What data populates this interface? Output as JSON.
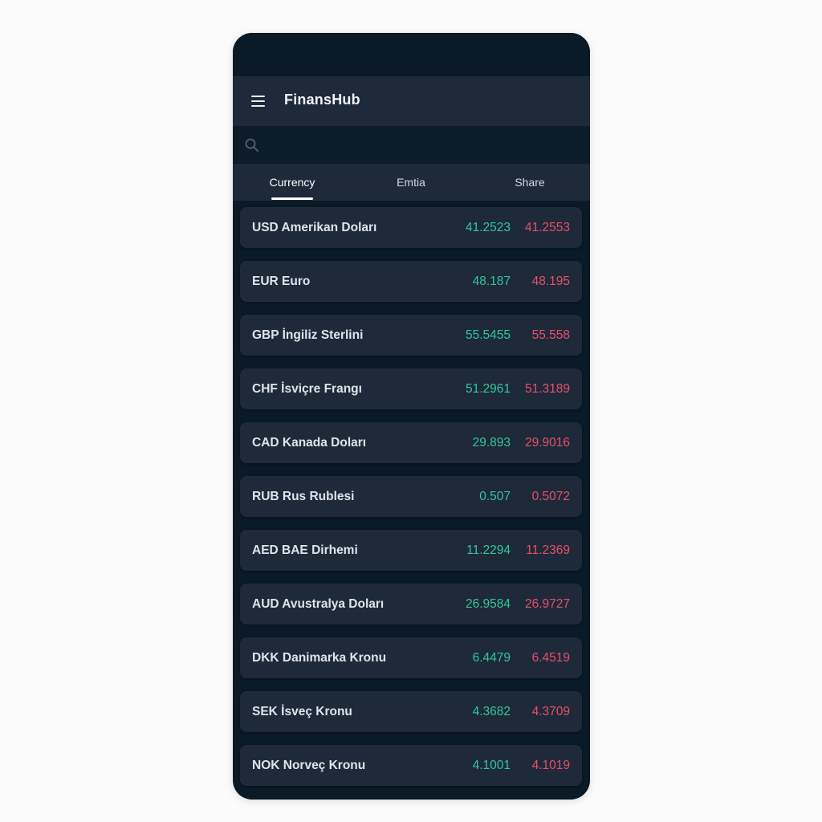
{
  "app": {
    "title": "FinansHub"
  },
  "search": {
    "placeholder": "",
    "value": ""
  },
  "tabs": [
    {
      "label": "Currency",
      "active": true
    },
    {
      "label": "Emtia",
      "active": false
    },
    {
      "label": "Share",
      "active": false
    }
  ],
  "colors": {
    "buy": "#35c79a",
    "sell": "#e8506a",
    "background": "#0a1a26",
    "card": "#1e293a"
  },
  "currencies": [
    {
      "name": "USD Amerikan Doları",
      "buy": "41.2523",
      "sell": "41.2553"
    },
    {
      "name": "EUR Euro",
      "buy": "48.187",
      "sell": "48.195"
    },
    {
      "name": "GBP İngiliz Sterlini",
      "buy": "55.5455",
      "sell": "55.558"
    },
    {
      "name": "CHF İsviçre Frangı",
      "buy": "51.2961",
      "sell": "51.3189"
    },
    {
      "name": "CAD Kanada Doları",
      "buy": "29.893",
      "sell": "29.9016"
    },
    {
      "name": "RUB Rus Rublesi",
      "buy": "0.507",
      "sell": "0.5072"
    },
    {
      "name": "AED BAE Dirhemi",
      "buy": "11.2294",
      "sell": "11.2369"
    },
    {
      "name": "AUD Avustralya Doları",
      "buy": "26.9584",
      "sell": "26.9727"
    },
    {
      "name": "DKK Danimarka Kronu",
      "buy": "6.4479",
      "sell": "6.4519"
    },
    {
      "name": "SEK İsveç Kronu",
      "buy": "4.3682",
      "sell": "4.3709"
    },
    {
      "name": "NOK Norveç Kronu",
      "buy": "4.1001",
      "sell": "4.1019"
    }
  ]
}
